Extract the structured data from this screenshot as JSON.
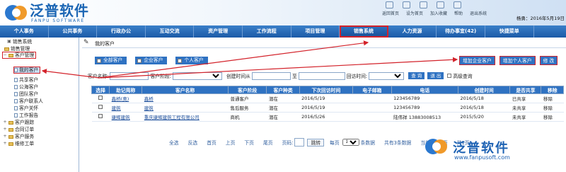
{
  "header": {
    "logo_text": "泛普软件",
    "logo_subtext": "FANPU SOFTWARE",
    "user_info": "杨勇：2016年5月19日 星",
    "top_icons": [
      "返回首页",
      "设为首页",
      "加入收藏",
      "帮助",
      "退出系统"
    ]
  },
  "nav": {
    "items": [
      "个人事务",
      "公共事务",
      "行政办公",
      "互动交流",
      "资产管理",
      "工作流程",
      "项目管理",
      "销售系统",
      "人力资源",
      "待办事宜(42)",
      "快捷菜单"
    ],
    "active_index": 7
  },
  "sidebar": {
    "root": "销售系统",
    "items": [
      "销售管理",
      "客户管理",
      "我的客户",
      "共享客户",
      "公海客户",
      "团队客户",
      "客户联系人",
      "客户关怀",
      "工作报告",
      "客户跟踪",
      "合同订单",
      "客户服务",
      "维修工单"
    ]
  },
  "content": {
    "breadcrumb": "我的客户",
    "tabs": [
      "全部客户",
      "企业客户",
      "个人客户"
    ],
    "actions": [
      "增加企业客户",
      "增加个人客户",
      "修 改"
    ],
    "filters": {
      "customer_name_label": "客户名称:",
      "stage_label": "客户阶段:",
      "created_from_label": "创建时间从",
      "to_label": "至",
      "visit_label": "回访时间:",
      "query_button": "查 询",
      "exit_button": "退 出",
      "advanced_label": "高级查询"
    },
    "columns": [
      "选择",
      "助记简称",
      "客户名称",
      "客户阶段",
      "客户种类",
      "下次回访时间",
      "电子邮箱",
      "电话",
      "创建时间",
      "是否共享",
      "移除"
    ],
    "rows": [
      [
        "",
        "鑫桥(奥)",
        "鑫桥",
        "普通客户",
        "潜在",
        "2016/5/19",
        "",
        "123456789",
        "2016/5/18",
        "已共享",
        "移除"
      ],
      [
        "",
        "建筑",
        "建筑",
        "售后服务",
        "潜在",
        "2016/5/19",
        "",
        "123456789",
        "2016/5/18",
        "未共享",
        "移除"
      ],
      [
        "",
        "康辉建筑",
        "重庆康辉建筑工程有限公司",
        "商机",
        "潜在",
        "2016/5/26",
        "",
        "陆伟祥 13883008513",
        "2015/5/20",
        "未共享",
        "移除"
      ]
    ]
  },
  "pager": {
    "items": [
      "全选",
      "反选",
      "首页",
      "上页",
      "下页",
      "尾页"
    ],
    "page_label": "页码:",
    "go_button": "跳转",
    "per_page_label": "每页",
    "per_page_value": "100",
    "per_page_unit": "条数据",
    "total": "共有3条数据",
    "current": "当前为第1页",
    "total_pages": "共1页"
  },
  "watermark": {
    "text": "泛普软件",
    "url": "www.fanpusoft.com"
  },
  "colors": {
    "accent": "#2f72c2",
    "nav": "#1b5aa7",
    "highlight": "#d3222a"
  }
}
